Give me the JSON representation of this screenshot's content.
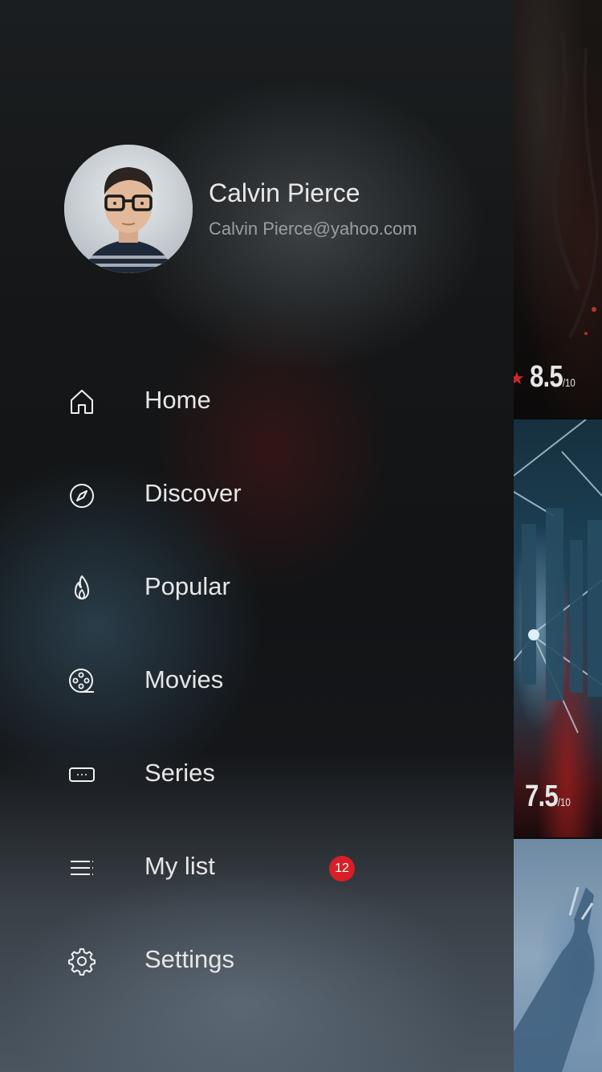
{
  "profile": {
    "name": "Calvin Pierce",
    "email": "Calvin Pierce@yahoo.com"
  },
  "menu": {
    "items": [
      {
        "label": "Home",
        "icon": "home-icon"
      },
      {
        "label": "Discover",
        "icon": "compass-icon"
      },
      {
        "label": "Popular",
        "icon": "flame-icon"
      },
      {
        "label": "Movies",
        "icon": "film-reel-icon"
      },
      {
        "label": "Series",
        "icon": "tv-icon"
      },
      {
        "label": "My list",
        "icon": "list-icon",
        "badge": "12"
      },
      {
        "label": "Settings",
        "icon": "gear-icon"
      }
    ]
  },
  "peek": {
    "cards": [
      {
        "rating": "8.5",
        "scale": "/10"
      },
      {
        "rating": "7.5",
        "scale": "/10"
      }
    ]
  },
  "colors": {
    "accent": "#d61f26",
    "text_primary": "#e6e6e6",
    "text_secondary": "#9a9ea2"
  }
}
